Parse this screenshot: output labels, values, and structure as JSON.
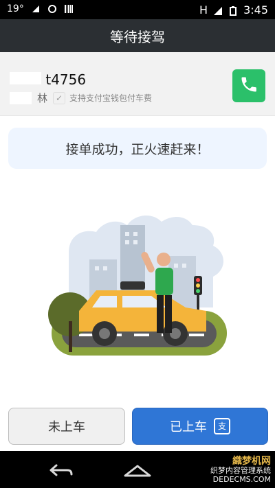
{
  "status_bar": {
    "temperature": "19°",
    "time": "3:45",
    "network": "H"
  },
  "app": {
    "title": "等待接驾"
  },
  "driver": {
    "plate_suffix": "t4756",
    "surname_suffix": "林",
    "payment_note": "支持支付宝钱包付车费"
  },
  "message": {
    "text": "接单成功，正火速赶来！"
  },
  "actions": {
    "not_boarded": "未上车",
    "boarded": "已上车"
  },
  "watermark": {
    "line1": "織梦机网",
    "line2": "织梦内容管理系统",
    "line3": "DEDECMS.COM"
  },
  "colors": {
    "app_bar": "#2b2f33",
    "call_button": "#2bc06a",
    "primary_button": "#2f76d6",
    "message_bg": "#eef5ff"
  },
  "icons": {
    "call": "phone-icon",
    "pay": "alipay-icon",
    "back": "back-icon",
    "home": "home-icon"
  }
}
